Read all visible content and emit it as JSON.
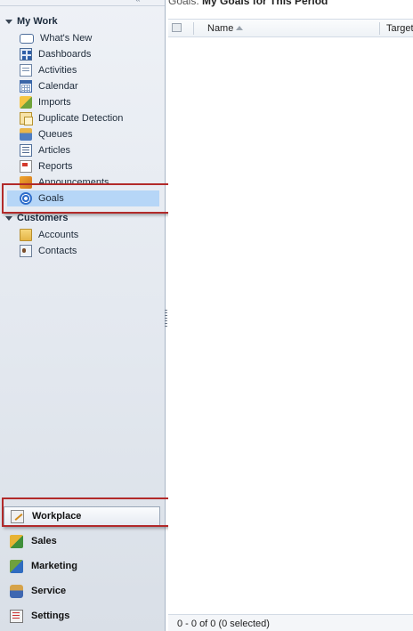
{
  "nav": {
    "groups": [
      {
        "title": "My Work",
        "items": [
          {
            "label": "What's New",
            "icon": "whats-new-icon"
          },
          {
            "label": "Dashboards",
            "icon": "dashboards-icon"
          },
          {
            "label": "Activities",
            "icon": "activities-icon"
          },
          {
            "label": "Calendar",
            "icon": "calendar-icon"
          },
          {
            "label": "Imports",
            "icon": "imports-icon"
          },
          {
            "label": "Duplicate Detection",
            "icon": "duplicate-detection-icon"
          },
          {
            "label": "Queues",
            "icon": "queues-icon"
          },
          {
            "label": "Articles",
            "icon": "articles-icon"
          },
          {
            "label": "Reports",
            "icon": "reports-icon"
          },
          {
            "label": "Announcements",
            "icon": "announcements-icon"
          },
          {
            "label": "Goals",
            "icon": "goals-icon",
            "selected": true
          }
        ]
      },
      {
        "title": "Customers",
        "items": [
          {
            "label": "Accounts",
            "icon": "accounts-icon"
          },
          {
            "label": "Contacts",
            "icon": "contacts-icon"
          }
        ]
      }
    ],
    "workspaces": [
      {
        "label": "Workplace",
        "icon": "workplace-icon",
        "active": true
      },
      {
        "label": "Sales",
        "icon": "sales-icon"
      },
      {
        "label": "Marketing",
        "icon": "marketing-icon"
      },
      {
        "label": "Service",
        "icon": "service-icon"
      },
      {
        "label": "Settings",
        "icon": "settings-icon"
      }
    ]
  },
  "content": {
    "title_prefix": "Goals:",
    "view_name": "My Goals for This Period",
    "columns": [
      "Name",
      "Target"
    ],
    "sort_column": "Name",
    "record_count": "0 - 0 of 0 (0 selected)"
  },
  "colors": {
    "selected_item_bg": "#b6d6f7",
    "highlight_box": "#b22a2a",
    "nav_bg": "#e3e8ef"
  }
}
